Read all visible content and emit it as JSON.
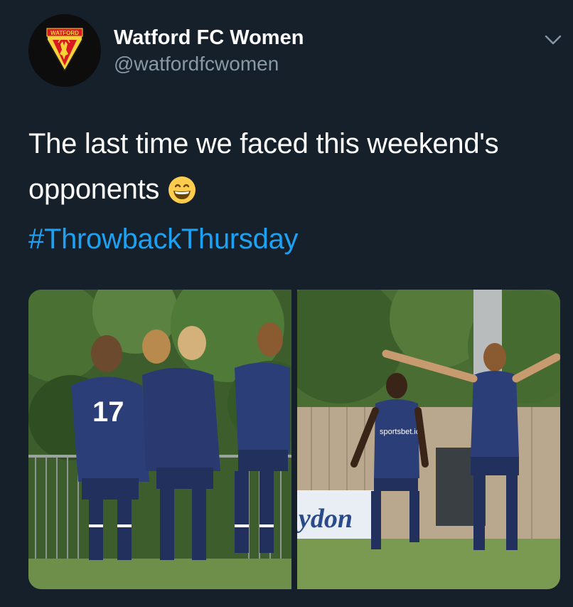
{
  "author": {
    "display_name": "Watford FC Women",
    "handle": "@watfordfcwomen",
    "avatar_badge_text": "WATFORD"
  },
  "tweet": {
    "text": "The last time we faced this weekend's opponents",
    "emoji": "grinning-face-with-smiling-eyes",
    "hashtag": "#ThrowbackThursday"
  },
  "media": [
    {
      "label": "photo-team-celebration",
      "shirt_number": "17"
    },
    {
      "label": "photo-player-celebration",
      "shirt_text": "sportsbet.io",
      "board_text": "ydon"
    }
  ],
  "colors": {
    "background": "#15202b",
    "text": "#ffffff",
    "secondary": "#8899a6",
    "link": "#1da1f2",
    "kit_navy": "#2c3e78",
    "badge_yellow": "#f7d33a",
    "badge_red": "#d71920"
  }
}
